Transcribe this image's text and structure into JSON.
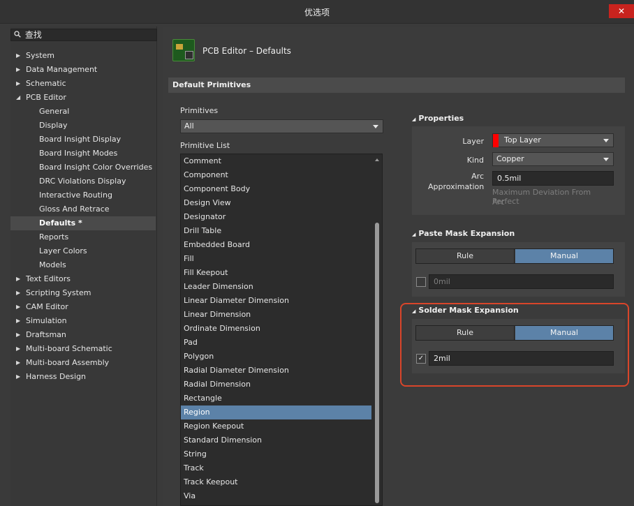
{
  "window": {
    "title": "优选项",
    "close_label": "✕"
  },
  "search": {
    "placeholder": "查找",
    "icon": "search-icon"
  },
  "tree": [
    {
      "label": "System",
      "level": 0,
      "expanded": false
    },
    {
      "label": "Data Management",
      "level": 0,
      "expanded": false
    },
    {
      "label": "Schematic",
      "level": 0,
      "expanded": false
    },
    {
      "label": "PCB Editor",
      "level": 0,
      "expanded": true
    },
    {
      "label": "General",
      "level": 1
    },
    {
      "label": "Display",
      "level": 1
    },
    {
      "label": "Board Insight Display",
      "level": 1
    },
    {
      "label": "Board Insight Modes",
      "level": 1
    },
    {
      "label": "Board Insight Color Overrides",
      "level": 1
    },
    {
      "label": "DRC Violations Display",
      "level": 1
    },
    {
      "label": "Interactive Routing",
      "level": 1
    },
    {
      "label": "Gloss And Retrace",
      "level": 1
    },
    {
      "label": "Defaults *",
      "level": 1,
      "selected": true
    },
    {
      "label": "Reports",
      "level": 1
    },
    {
      "label": "Layer Colors",
      "level": 1
    },
    {
      "label": "Models",
      "level": 1
    },
    {
      "label": "Text Editors",
      "level": 0,
      "expanded": false
    },
    {
      "label": "Scripting System",
      "level": 0,
      "expanded": false
    },
    {
      "label": "CAM Editor",
      "level": 0,
      "expanded": false
    },
    {
      "label": "Simulation",
      "level": 0,
      "expanded": false
    },
    {
      "label": "Draftsman",
      "level": 0,
      "expanded": false
    },
    {
      "label": "Multi-board Schematic",
      "level": 0,
      "expanded": false
    },
    {
      "label": "Multi-board Assembly",
      "level": 0,
      "expanded": false
    },
    {
      "label": "Harness Design",
      "level": 0,
      "expanded": false
    }
  ],
  "page": {
    "title": "PCB Editor – Defaults",
    "section": "Default Primitives",
    "primitives_label": "Primitives",
    "primitives_value": "All",
    "list_label": "Primitive List",
    "list": [
      "Comment",
      "Component",
      "Component Body",
      "Design View",
      "Designator",
      "Drill Table",
      "Embedded Board",
      "Fill",
      "Fill Keepout",
      "Leader Dimension",
      "Linear Diameter Dimension",
      "Linear Dimension",
      "Ordinate Dimension",
      "Pad",
      "Polygon",
      "Radial Diameter Dimension",
      "Radial Dimension",
      "Rectangle",
      "Region",
      "Region Keepout",
      "Standard Dimension",
      "String",
      "Track",
      "Track Keepout",
      "Via"
    ],
    "selected_index": 18
  },
  "properties": {
    "title": "Properties",
    "layer_label": "Layer",
    "layer_value": "Top Layer",
    "layer_color": "#ff0000",
    "kind_label": "Kind",
    "kind_value": "Copper",
    "arc_label_1": "Arc",
    "arc_label_2": "Approximation",
    "arc_value": "0.5mil",
    "arc_hint_1": "Maximum Deviation From Perfect",
    "arc_hint_2": "Arc"
  },
  "paste_mask": {
    "title": "Paste Mask Expansion",
    "rule_label": "Rule",
    "manual_label": "Manual",
    "checked": false,
    "value": "0mil"
  },
  "solder_mask": {
    "title": "Solder Mask Expansion",
    "rule_label": "Rule",
    "manual_label": "Manual",
    "checked": true,
    "check_glyph": "✓",
    "value": "2mil"
  },
  "colors": {
    "accent": "#5c82a8",
    "highlight": "#d9452a",
    "close": "#c8231e"
  }
}
